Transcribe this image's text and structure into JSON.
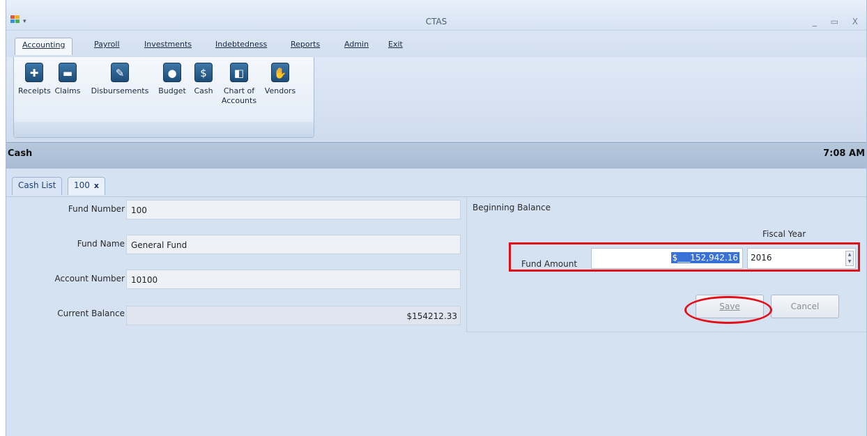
{
  "window": {
    "title": "CTAS",
    "quick_access": "▾",
    "controls": [
      "_",
      "▭",
      "X"
    ]
  },
  "menu": {
    "tabs": [
      "Accounting",
      "Payroll",
      "Investments",
      "Indebtedness",
      "Reports",
      "Admin",
      "Exit"
    ],
    "active": "Accounting"
  },
  "ribbon": {
    "buttons": [
      {
        "label": "Receipts",
        "icon": "receipts-icon"
      },
      {
        "label": "Claims",
        "icon": "claims-icon"
      },
      {
        "label": "Disbursements",
        "icon": "disbursements-icon"
      },
      {
        "label": "Budget",
        "icon": "budget-piggybank-icon"
      },
      {
        "label": "Cash",
        "icon": "cash-icon"
      },
      {
        "label": "Chart of",
        "label2": "Accounts",
        "icon": "chart-of-accounts-icon"
      },
      {
        "label": "Vendors",
        "icon": "vendors-handshake-icon"
      }
    ]
  },
  "section": {
    "title": "Cash",
    "time": "7:08 AM"
  },
  "doc_tabs": {
    "list_tab": "Cash List",
    "active_tab": "100",
    "close_glyph": "x"
  },
  "form": {
    "fund_number_label": "Fund Number",
    "fund_number": "100",
    "fund_name_label": "Fund Name",
    "fund_name": "General Fund",
    "account_number_label": "Account Number",
    "account_number": "10100",
    "current_balance_label": "Current Balance",
    "current_balance": "$154212.33"
  },
  "beginning_balance": {
    "title": "Beginning Balance",
    "fiscal_year_label": "Fiscal Year",
    "fund_amount_label": "Fund Amount",
    "fund_amount": "$___152,942.16",
    "fiscal_year": "2016",
    "save_label": "Save",
    "cancel_label": "Cancel"
  },
  "colors": {
    "highlight": "#e3101a",
    "selection": "#3a71d6",
    "background": "#d5e2f2"
  }
}
